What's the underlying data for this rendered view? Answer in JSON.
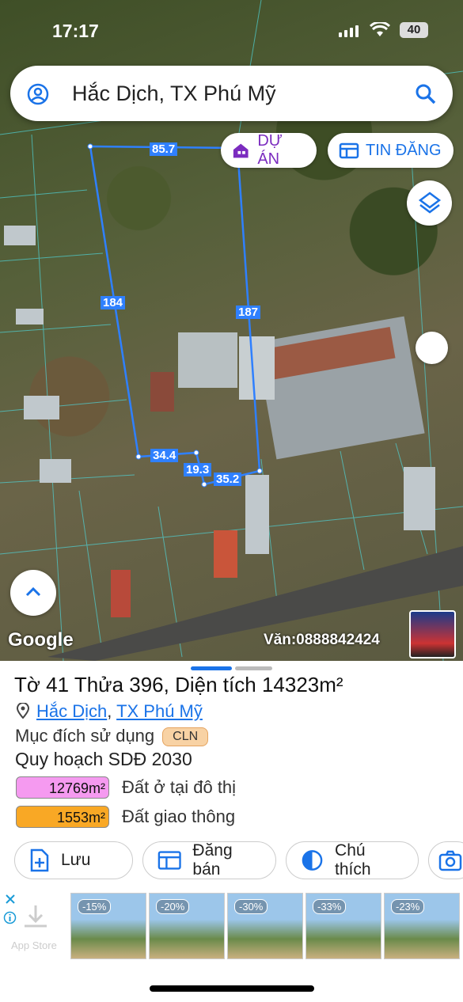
{
  "status_bar": {
    "time": "17:17",
    "battery": "40"
  },
  "search": {
    "text": "Hắc Dịch, TX Phú Mỹ"
  },
  "map_buttons": {
    "project_label": "DỰ ÁN",
    "listing_label": "TIN ĐĂNG"
  },
  "parcel_edges": [
    "85.7",
    "184",
    "187",
    "34.4",
    "19.3",
    "35.2"
  ],
  "map_footer": {
    "google": "Google",
    "watermark": "Văn:0888842424"
  },
  "parcel": {
    "title_prefix": "Tờ ",
    "sheet_no": "41",
    "parcel_word": " Thửa ",
    "parcel_no": "396",
    "area_prefix": ", Diện tích ",
    "area": "14323m²",
    "commune": "Hắc Dịch",
    "separator": ", ",
    "town": "TX Phú Mỹ",
    "purpose_label": "Mục đích sử dụng",
    "purpose_code": "CLN",
    "plan_title": "Quy hoạch SDĐ 2030",
    "zones": [
      {
        "area": "12769m²",
        "label": "Đất ở tại đô thị",
        "color": "#f59af0"
      },
      {
        "area": "1553m²",
        "label": "Đất giao thông",
        "color": "#f9a825"
      }
    ]
  },
  "actions": {
    "save": "Lưu",
    "sell": "Đăng bán",
    "legend": "Chú thích"
  },
  "ad": {
    "store_label": "App Store",
    "discounts": [
      "-15%",
      "-20%",
      "-30%",
      "-33%",
      "-23%"
    ]
  },
  "colors": {
    "accent": "#1a73e8",
    "project": "#7b2cbf",
    "parcel_line": "#2f80ff"
  }
}
